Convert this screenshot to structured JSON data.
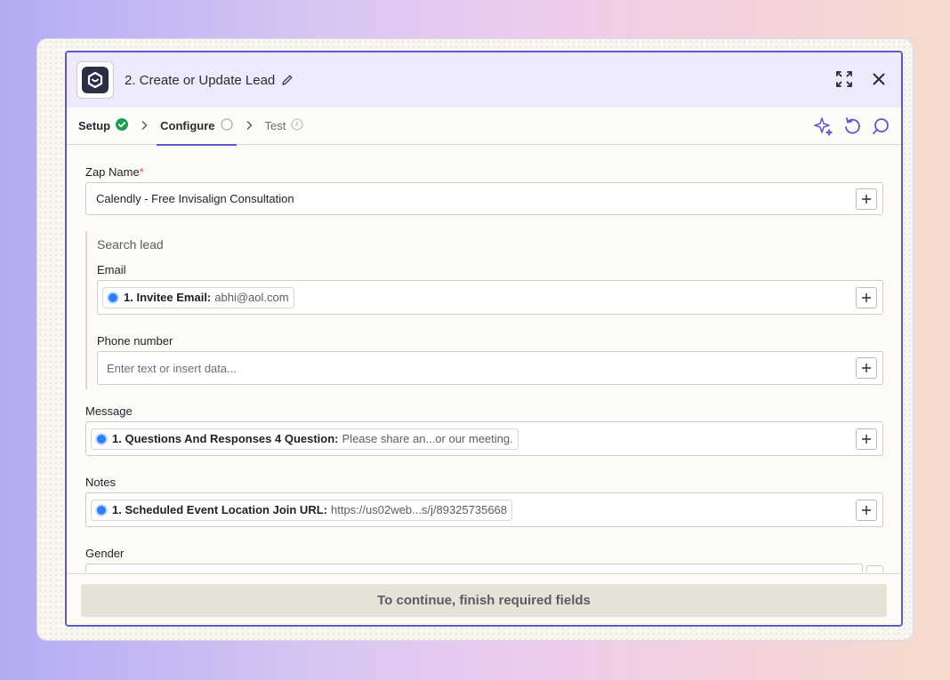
{
  "header": {
    "title": "2. Create or Update Lead",
    "app_icon": "lead-app-logo"
  },
  "steps": [
    {
      "label": "Setup",
      "status": "complete"
    },
    {
      "label": "Configure",
      "status": "current"
    },
    {
      "label": "Test",
      "status": "pending"
    }
  ],
  "fields": {
    "zap_name": {
      "label": "Zap Name",
      "required_mark": "*",
      "value": "Calendly  - Free Invisalign Consultation"
    },
    "search_group_title": "Search lead",
    "email": {
      "label": "Email",
      "token_key": "1. Invitee Email:",
      "token_value": "abhi@aol.com"
    },
    "phone": {
      "label": "Phone number",
      "placeholder": "Enter text or insert data..."
    },
    "message": {
      "label": "Message",
      "token_key": "1. Questions And Responses 4 Question:",
      "token_value": "Please share an...or our meeting."
    },
    "notes": {
      "label": "Notes",
      "token_key": "1. Scheduled Event Location Join URL:",
      "token_value": "https://us02web...s/j/89325735668"
    },
    "gender": {
      "label": "Gender"
    }
  },
  "footer": {
    "continue_label": "To continue, finish required fields"
  },
  "colors": {
    "accent": "#5c5acb",
    "success": "#1f9d55",
    "token_dot": "#2d7ff9"
  }
}
